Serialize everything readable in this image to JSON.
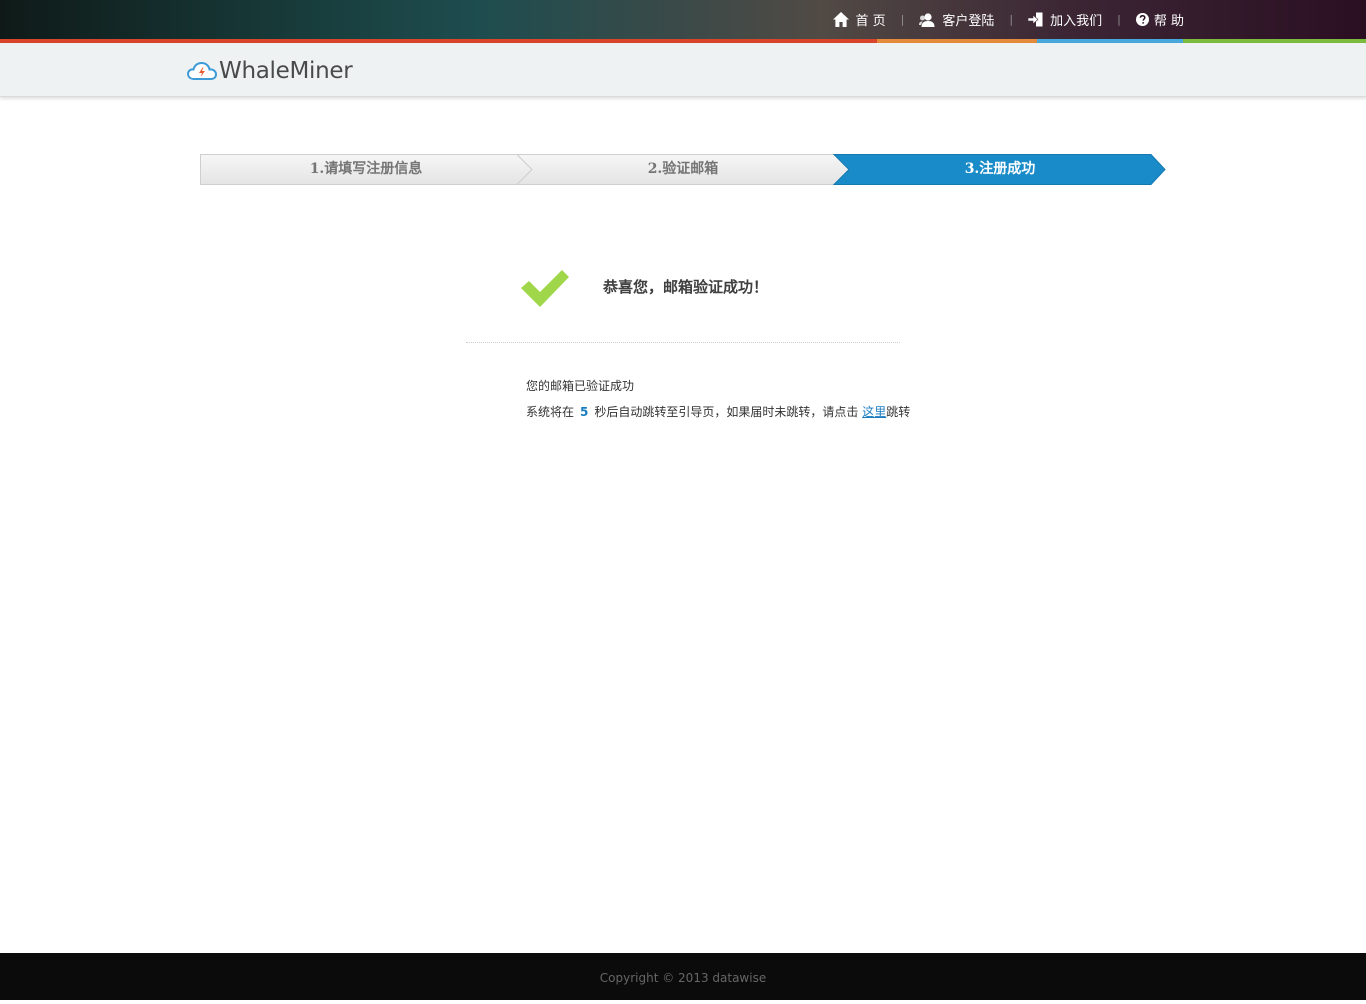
{
  "topnav": {
    "items": [
      {
        "label": "首 页",
        "icon": "home-icon"
      },
      {
        "label": "客户登陆",
        "icon": "user-icon"
      },
      {
        "label": "加入我们",
        "icon": "sign-in-icon"
      },
      {
        "label": "帮 助",
        "icon": "question-circle-icon"
      }
    ],
    "separator": "|"
  },
  "colors": {
    "accent_red": "#d9452b",
    "accent_orange": "#e38b3b",
    "accent_blue": "#47a8dc",
    "accent_green": "#7dbb3f",
    "step_active": "#1a8bc9",
    "check_green": "#9fd64a",
    "link_blue": "#1a7cc1"
  },
  "logo": {
    "text": "WhaleMiner"
  },
  "steps": [
    {
      "label": "1.请填写注册信息",
      "active": false
    },
    {
      "label": "2.验证邮箱",
      "active": false
    },
    {
      "label": "3.注册成功",
      "active": true
    }
  ],
  "success": {
    "title": "恭喜您，邮箱验证成功！",
    "line1": "您的邮箱已验证成功",
    "line2_prefix": "系统将在",
    "countdown": "5",
    "line2_middle": "秒后自动跳转至引导页，如果届时未跳转，请点击",
    "link_text": "这里",
    "line2_suffix": "跳转"
  },
  "footer": {
    "copyright": "Copyright © 2013 datawise"
  }
}
